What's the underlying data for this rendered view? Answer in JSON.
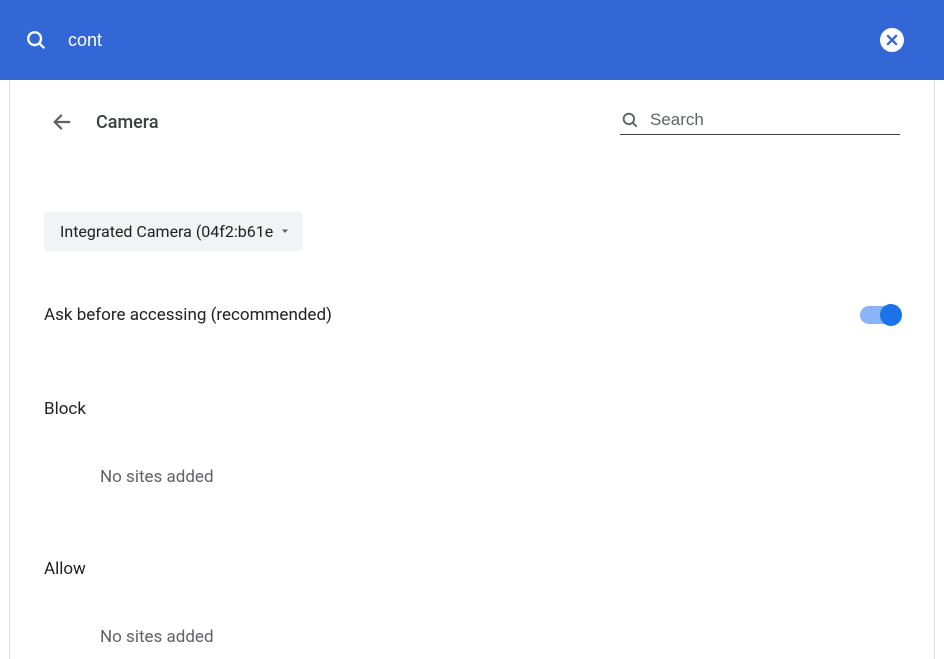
{
  "topbar": {
    "search_value": "cont"
  },
  "page": {
    "title": "Camera",
    "search_placeholder": "Search"
  },
  "camera_select": {
    "label": "Integrated Camera (04f2:b61e"
  },
  "toggle_row": {
    "label": "Ask before accessing (recommended)",
    "enabled": true
  },
  "block_section": {
    "heading": "Block",
    "empty_text": "No sites added"
  },
  "allow_section": {
    "heading": "Allow",
    "empty_text": "No sites added"
  }
}
